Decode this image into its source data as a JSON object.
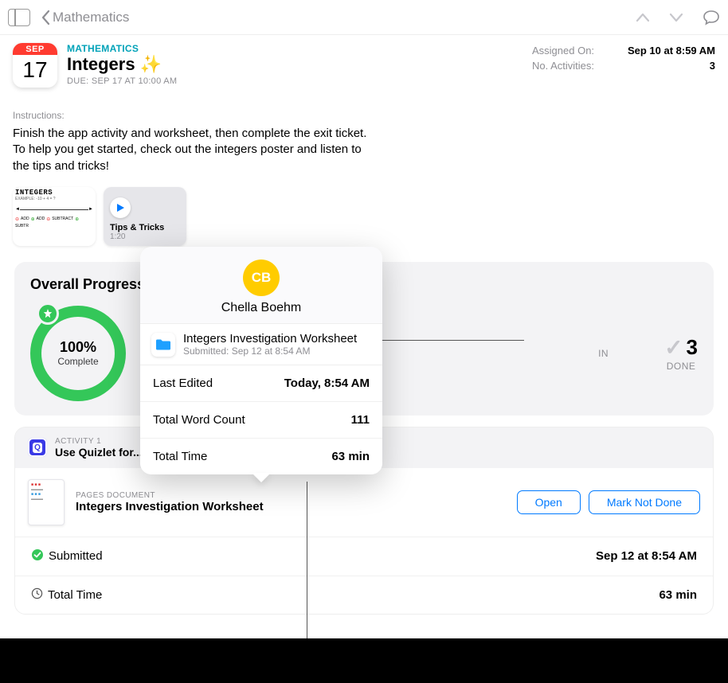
{
  "nav": {
    "back_label": "Mathematics"
  },
  "header": {
    "cal_month": "SEP",
    "cal_day": "17",
    "category": "MATHEMATICS",
    "title": "Integers",
    "sparkle": "✨",
    "due": "DUE: SEP 17 AT 10:00 AM"
  },
  "meta": {
    "assigned_label": "Assigned On:",
    "assigned_value": "Sep 10 at 8:59 AM",
    "activities_label": "No. Activities:",
    "activities_value": "3"
  },
  "instructions": {
    "label": "Instructions:",
    "text": "Finish the app activity and worksheet, then complete the exit ticket. To help you get started, check out the integers poster and listen to the tips and tricks!"
  },
  "attachments": {
    "poster_title": "INTEGERS",
    "media_title": "Tips & Tricks",
    "media_duration": "1:20"
  },
  "progress": {
    "heading": "Overall Progress",
    "percent": "100%",
    "percent_label": "Complete",
    "stat_in_label": "IN",
    "done_value": "3",
    "done_label": "DONE"
  },
  "activity1": {
    "label": "ACTIVITY 1",
    "title": "Use Quizlet for..."
  },
  "document": {
    "type_label": "PAGES DOCUMENT",
    "name": "Integers Investigation Worksheet",
    "open_btn": "Open",
    "mark_btn": "Mark Not Done"
  },
  "details": {
    "submitted_label": "Submitted",
    "submitted_value": "Sep 12 at 8:54 AM",
    "time_label": "Total Time",
    "time_value": "63 min"
  },
  "popover": {
    "initials": "CB",
    "name": "Chella Boehm",
    "file_title": "Integers Investigation Worksheet",
    "file_submitted": "Submitted: Sep 12 at 8:54 AM",
    "last_edited_label": "Last Edited",
    "last_edited_value": "Today, 8:54 AM",
    "word_count_label": "Total Word Count",
    "word_count_value": "111",
    "total_time_label": "Total Time",
    "total_time_value": "63 min"
  }
}
